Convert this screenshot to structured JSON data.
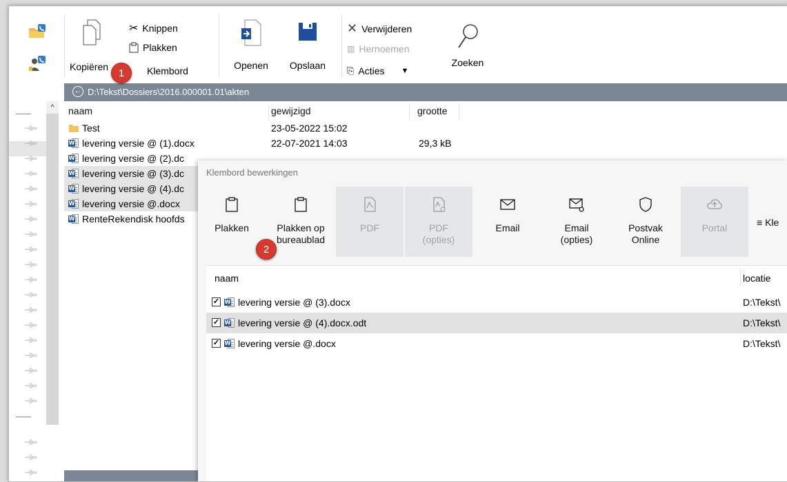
{
  "ribbon": {
    "copy_label": "Kopiëren",
    "cut_label": "Knippen",
    "paste_label": "Plakken",
    "clipboard_label": "Klembord",
    "open_label": "Openen",
    "save_label": "Opslaan",
    "delete_label": "Verwijderen",
    "rename_label": "Hernoemen",
    "actions_label": "Acties",
    "search_label": "Zoeken"
  },
  "path": "D:\\Tekst\\Dossiers\\2016.000001.01\\akten",
  "filelist": {
    "columns": [
      "naam",
      "gewijzigd",
      "grootte"
    ],
    "rows": [
      {
        "name": "Test",
        "modified": "23-05-2022 15:02",
        "size": "",
        "type": "folder"
      },
      {
        "name": "levering versie @ (1).docx",
        "modified": "22-07-2021 14:03",
        "size": "29,3 kB",
        "type": "word"
      },
      {
        "name": "levering versie @ (2).dc",
        "modified": "",
        "size": "",
        "type": "word"
      },
      {
        "name": "levering versie @ (3).dc",
        "modified": "",
        "size": "",
        "type": "word"
      },
      {
        "name": "levering versie @ (4).dc",
        "modified": "",
        "size": "",
        "type": "word"
      },
      {
        "name": "levering versie @.docx",
        "modified": "",
        "size": "",
        "type": "word"
      },
      {
        "name": "RenteRekendisk hoofds",
        "modified": "",
        "size": "",
        "type": "word"
      }
    ]
  },
  "popup": {
    "title": "Klembord bewerkingen",
    "tools": [
      {
        "label1": "Plakken",
        "label2": "",
        "icon": "clipboard-icon",
        "disabled": false
      },
      {
        "label1": "Plakken op",
        "label2": "bureaublad",
        "icon": "clipboard-icon",
        "disabled": false
      },
      {
        "label1": "PDF",
        "label2": "",
        "icon": "pdf-icon",
        "disabled": true
      },
      {
        "label1": "PDF",
        "label2": "(opties)",
        "icon": "pdf-settings-icon",
        "disabled": true
      },
      {
        "label1": "Email",
        "label2": "",
        "icon": "mail-icon",
        "disabled": false
      },
      {
        "label1": "Email",
        "label2": "(opties)",
        "icon": "mail-settings-icon",
        "disabled": false
      },
      {
        "label1": "Postvak",
        "label2": "Online",
        "icon": "shield-icon",
        "disabled": false
      },
      {
        "label1": "Portal",
        "label2": "",
        "icon": "cloud-upload-icon",
        "disabled": true
      }
    ],
    "menu_label": "Kle",
    "columns": [
      "naam",
      "locatie"
    ],
    "rows": [
      {
        "name": "levering versie @ (3).docx",
        "location": "D:\\Tekst\\",
        "checked": true
      },
      {
        "name": "levering versie @ (4).docx.odt",
        "location": "D:\\Tekst\\",
        "checked": true
      },
      {
        "name": "levering versie @.docx",
        "location": "D:\\Tekst\\",
        "checked": true
      }
    ]
  },
  "callouts": [
    "1",
    "2"
  ],
  "colors": {
    "pathbar": "#7b8794",
    "callout": "#d63a2f",
    "selection": "#e4e4e4"
  }
}
